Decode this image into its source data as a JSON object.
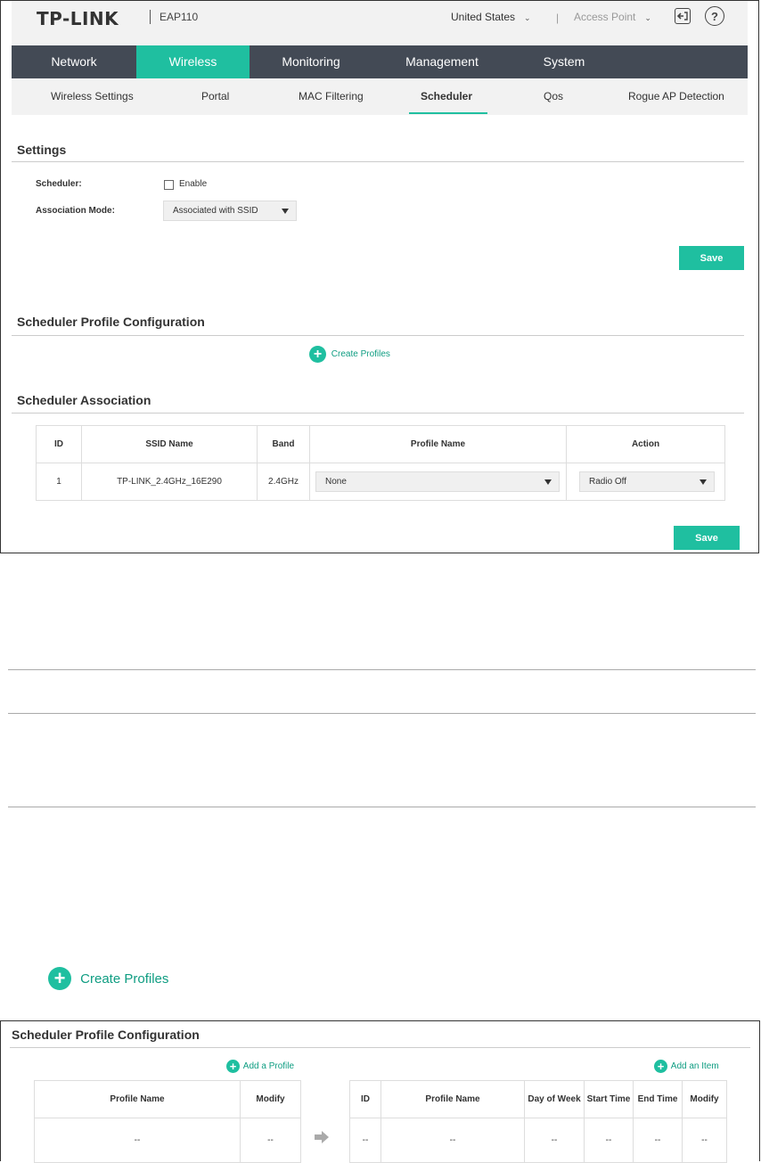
{
  "header": {
    "brand": "TP-LINK",
    "model": "EAP110",
    "region": "United States",
    "separator": "|",
    "mode": "Access Point",
    "help_glyph": "?"
  },
  "main_nav": [
    "Network",
    "Wireless",
    "Monitoring",
    "Management",
    "System"
  ],
  "main_nav_active": "Wireless",
  "sub_nav": [
    "Wireless Settings",
    "Portal",
    "MAC Filtering",
    "Scheduler",
    "Qos",
    "Rogue AP Detection"
  ],
  "sub_nav_active": "Scheduler",
  "settings": {
    "title": "Settings",
    "scheduler_label": "Scheduler:",
    "enable_label": "Enable",
    "enabled": false,
    "association_label": "Association Mode:",
    "association_value": "Associated with SSID",
    "save": "Save"
  },
  "profile_config": {
    "title": "Scheduler Profile Configuration",
    "create": "Create Profiles"
  },
  "association": {
    "title": "Scheduler Association",
    "columns": [
      "ID",
      "SSID Name",
      "Band",
      "Profile Name",
      "Action"
    ],
    "rows": [
      {
        "id": "1",
        "ssid": "TP-LINK_2.4GHz_16E290",
        "band": "2.4GHz",
        "profile": "None",
        "action": "Radio Off"
      }
    ],
    "save": "Save"
  },
  "create_big": "Create Profiles",
  "profile_config2": {
    "title": "Scheduler Profile Configuration",
    "add_profile": "Add a Profile",
    "add_item": "Add an Item",
    "left_columns": [
      "Profile Name",
      "Modify"
    ],
    "left_row": [
      "--",
      "--"
    ],
    "right_columns": [
      "ID",
      "Profile Name",
      "Day of Week",
      "Start Time",
      "End Time",
      "Modify"
    ],
    "right_row": [
      "--",
      "--",
      "--",
      "--",
      "--",
      "--"
    ]
  },
  "icons": {
    "logout": "logout-icon",
    "help": "help-icon",
    "plus": "plus-circle-icon",
    "arrow": "arrow-right-icon",
    "caret": "caret-down-icon"
  },
  "colors": {
    "accent": "#1fbfa0",
    "nav_bg": "#434a55",
    "link": "#0f9d82"
  }
}
